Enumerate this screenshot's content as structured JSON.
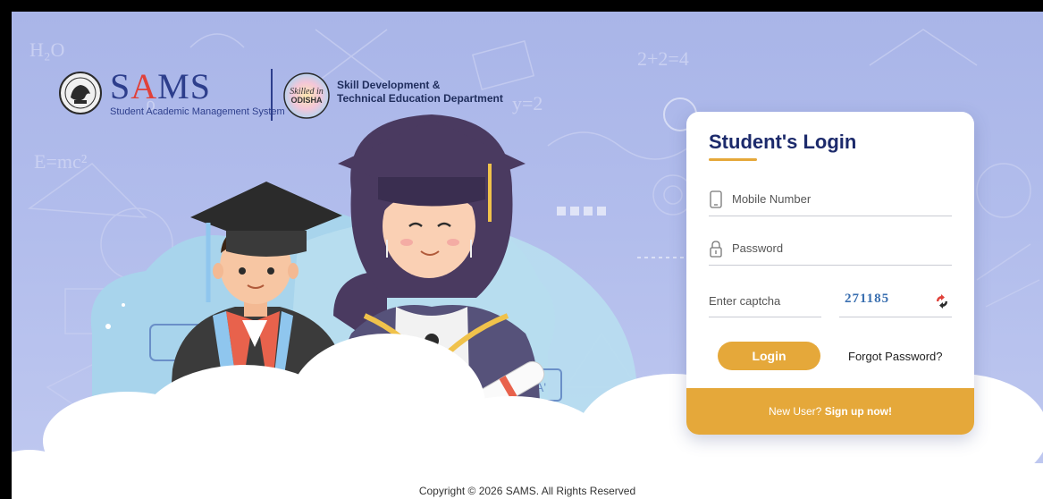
{
  "brand": {
    "sams_prefix": "S",
    "sams_accent": "A",
    "sams_suffix": "MS",
    "sams_subtitle": "Student Academic Management System",
    "odisha_logo_text_1": "Skilled in",
    "odisha_logo_text_2": "ODISHA",
    "department_line_1": "Skill Development &",
    "department_line_2": "Technical Education Department"
  },
  "login": {
    "title": "Student's Login",
    "mobile_placeholder": "Mobile Number",
    "password_placeholder": "Password",
    "captcha_placeholder": "Enter captcha",
    "captcha_code": "271185",
    "login_label": "Login",
    "forgot_label": "Forgot Password?",
    "new_user_label": "New User?",
    "signup_label": "Sign up now!"
  },
  "footer": {
    "copyright": "Copyright © 2026 SAMS. All Rights Reserved"
  },
  "colors": {
    "accent": "#e5a83a",
    "title_navy": "#1c2a6b",
    "background": "#b2bdec"
  },
  "icons": [
    "emblem-icon",
    "skilled-odisha-logo",
    "mobile-icon",
    "lock-icon",
    "refresh-icon"
  ]
}
